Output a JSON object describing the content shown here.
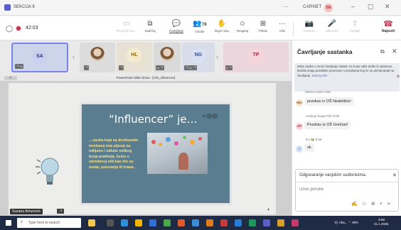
{
  "window": {
    "title": "SEKCIJA 6",
    "more": "···",
    "user_name": "CARNET",
    "user_initials": "SN",
    "buttons": [
      "–",
      "▢",
      "✕"
    ]
  },
  "toolbar": {
    "timer": "42:03",
    "buttons": [
      {
        "label": "Prozorni kon...",
        "icon": "▭",
        "disabled": true
      },
      {
        "label": "Sadržaj",
        "icon": "⧉"
      },
      {
        "label": "Čavrljanje",
        "icon": "💬",
        "active": true
      },
      {
        "label": "Osobe",
        "icon": "👥",
        "count": "78"
      },
      {
        "label": "Digni ruku",
        "icon": "✋"
      },
      {
        "label": "Reagiraj",
        "icon": "☺"
      },
      {
        "label": "Prikaz",
        "icon": "⊞"
      },
      {
        "label": "Više",
        "icon": "···"
      },
      {
        "label": "Kamera",
        "icon": "📷",
        "disabled": true
      },
      {
        "label": "Mikrofon",
        "icon": "🎤",
        "disabled": true
      },
      {
        "label": "Podijeli",
        "icon": "⇧",
        "disabled": true
      }
    ],
    "leave": {
      "label": "Napusti",
      "icon": "☎"
    }
  },
  "participants": [
    {
      "initials": "SA",
      "bg": "#d3d9f0",
      "fg": "#2a3a7a",
      "selected": true
    },
    {
      "initials": "",
      "photo": true
    },
    {
      "initials": "HL",
      "bg": "#f3ead0",
      "fg": "#8a6a10"
    },
    {
      "initials": "",
      "photo": true
    },
    {
      "initials": "NG",
      "bg": "#d8e0f2",
      "fg": "#334a90"
    },
    {
      "initials": "TP",
      "bg": "#f6d4dc",
      "fg": "#a02a4a"
    }
  ],
  "stage": {
    "sharing_title": "PowerPoint Slide Show - [CW_influencer]",
    "share_tag": "⇱",
    "presenter": "Suzana Antunović"
  },
  "slide": {
    "heading": "“Influencer” je…",
    "body": "…osoba koja na društvenim mrežama ima utjecaj na milijunu i odluke velikog broja pratitelja, često u određenoj niši kao što su moda, putovanja ili hrana.",
    "page": "4",
    "colors": {
      "card": "#5a7d8f",
      "body_text": "#f7e08a"
    }
  },
  "chat": {
    "title": "Čavrljanje sastanka",
    "notice": "Neke osobe u ovom čavrljanju nalaze se izvan vaše tvrtke ili ustanove. Možda imaju pravilnike povezane s porukama koji će se primjenjivati na čavrljanje.",
    "notice_link": "Saznaj više",
    "truncated_meta": "Mirela Grubić 8:58",
    "messages": [
      {
        "initials": "MG",
        "bg": "#f8e2c8",
        "fg": "#a0561a",
        "meta": "",
        "text": "pozdrav iz OŠ Nedelišće!"
      },
      {
        "initials": "AP",
        "bg": "#f7d3d8",
        "fg": "#b3304a",
        "meta": "Andreja Šopar Pilić  8:58",
        "text": "Pozdrav iz OŠ Goričan!"
      },
      {
        "initials": "I",
        "bg": "#d4e3f2",
        "fg": "#2a5a90",
        "meta": "leo 🐝  8:58",
        "text": "ok"
      }
    ],
    "reply": {
      "label": "Odgovaranje vanjskim sudionicima.",
      "placeholder": "Unos poruke",
      "icons": "✍☺⊛+➢"
    }
  },
  "taskbar": {
    "search_placeholder": "Type here to search",
    "tray": "🌨 Afta...  ⌃  HRV",
    "time": "8:58",
    "date": "21.1.2026."
  }
}
